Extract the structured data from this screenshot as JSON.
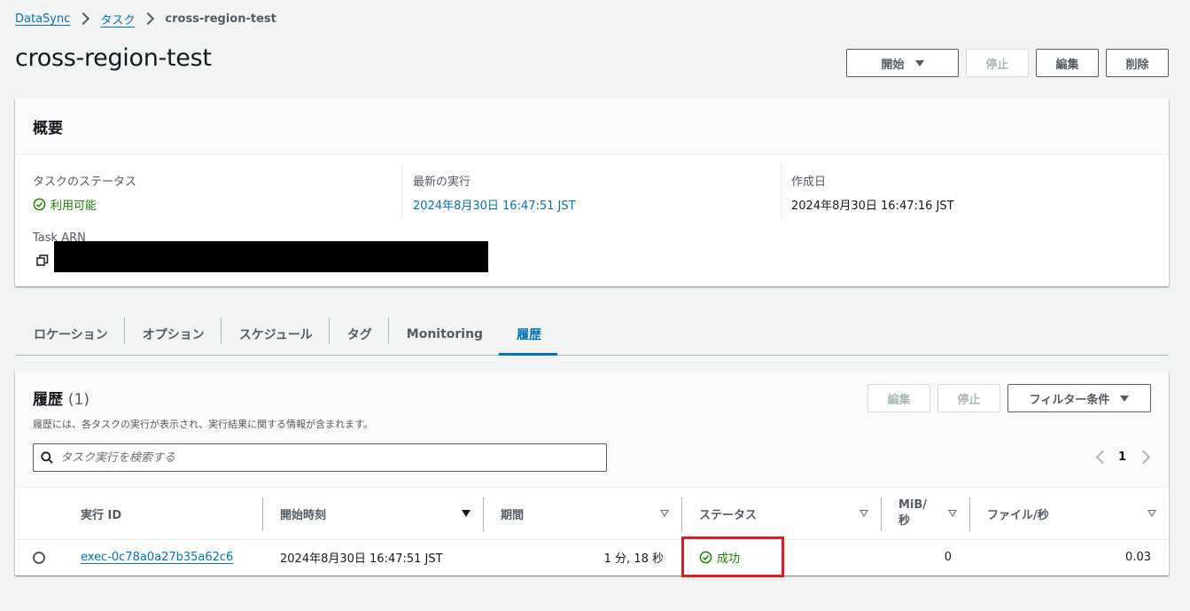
{
  "breadcrumb": {
    "root": "DataSync",
    "section": "タスク",
    "current": "cross-region-test"
  },
  "page": {
    "title": "cross-region-test"
  },
  "header_actions": {
    "start": "開始",
    "stop": "停止",
    "edit": "編集",
    "delete": "削除"
  },
  "overview": {
    "title": "概要",
    "task_status_label": "タスクのステータス",
    "task_status_value": "利用可能",
    "latest_exec_label": "最新の実行",
    "latest_exec_value": "2024年8月30日 16:47:51 JST",
    "created_label": "作成日",
    "created_value": "2024年8月30日 16:47:16 JST",
    "arn_label": "Task ARN"
  },
  "tabs": [
    "ロケーション",
    "オプション",
    "スケジュール",
    "タグ",
    "Monitoring",
    "履歴"
  ],
  "history": {
    "title": "履歴",
    "count": "(1)",
    "description": "履歴には、各タスクの実行が表示され、実行結果に関する情報が含まれます。",
    "edit": "編集",
    "stop": "停止",
    "filter": "フィルター条件",
    "search_placeholder": "タスク実行を検索する",
    "page": "1",
    "columns": {
      "exec_id": "実行 ID",
      "start_time": "開始時刻",
      "duration": "期間",
      "status": "ステータス",
      "mib_line1": "MiB/",
      "mib_line2": "秒",
      "files_per_sec": "ファイル/秒"
    },
    "rows": [
      {
        "exec_id": "exec-0c78a0a27b35a62c6",
        "start_time": "2024年8月30日 16:47:51 JST",
        "duration": "1 分, 18 秒",
        "status": "成功",
        "mib": "0",
        "files": "0.03"
      }
    ]
  },
  "colors": {
    "link": "#0073bb",
    "success": "#1d8102",
    "highlight": "#e11b22"
  }
}
